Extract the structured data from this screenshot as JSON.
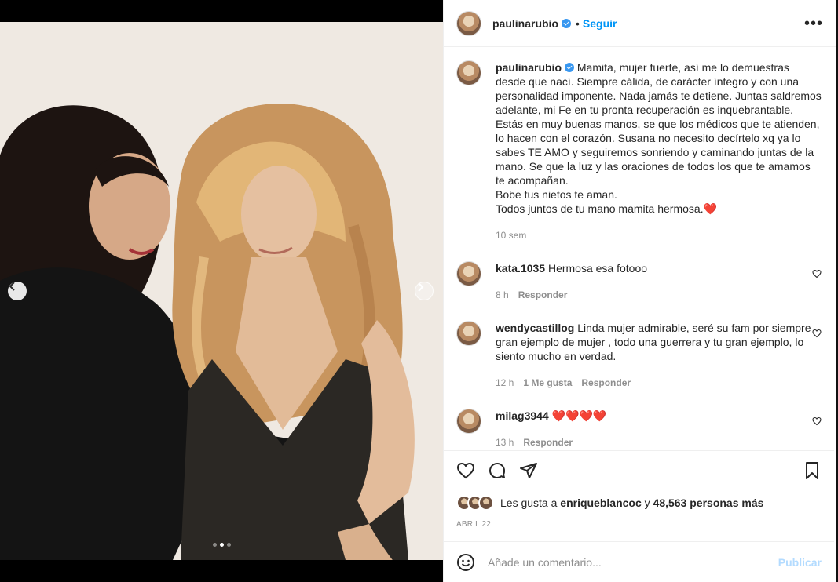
{
  "post": {
    "author": "paulinarubio",
    "follow_label": "Seguir",
    "more_label": "•••",
    "caption_author": "paulinarubio",
    "caption": "Mamita, mujer fuerte, así me lo demuestras desde que nací. Siempre cálida, de carácter íntegro y con una personalidad imponente. Nada jamás te detiene. Juntas saldremos adelante, mi Fe en tu pronta recuperación es inquebrantable. Estás en muy buenas manos, se que los médicos que te atienden, lo hacen con el corazón. Susana no necesito decírtelo xq ya lo sabes TE AMO y seguiremos sonriendo y caminando juntas de la mano. Se que la luz y las oraciones de todos los que te amamos te acompañan.\nBobe tus nietos te aman.\nTodos juntos de tu mano mamita hermosa.❤️",
    "caption_time": "10 sem"
  },
  "carousel": {
    "total": 3,
    "active_index": 1
  },
  "comments": [
    {
      "user": "kata.1035",
      "text": "Hermosa esa fotooo",
      "time": "8 h",
      "likes": "",
      "reply": "Responder"
    },
    {
      "user": "wendycastillog",
      "text": "Linda mujer admirable, seré su fam por siempre gran ejemplo de mujer , todo una guerrera y tu gran ejemplo, lo siento mucho en verdad.",
      "time": "12 h",
      "likes": "1 Me gusta",
      "reply": "Responder"
    },
    {
      "user": "milag3944",
      "text": "❤️❤️❤️❤️",
      "time": "13 h",
      "likes": "",
      "reply": "Responder"
    }
  ],
  "likes": {
    "prefix": "Les gusta a",
    "user": "enriqueblancoc",
    "middle": "y",
    "count": "48,563 personas más"
  },
  "date": "ABRIL 22",
  "add_comment": {
    "placeholder": "Añade un comentario...",
    "publish_label": "Publicar"
  },
  "colors": {
    "accent": "#0095f6",
    "verified": "#3897f0",
    "heart": "#ed4956",
    "publish_disabled": "#b3dbff"
  }
}
